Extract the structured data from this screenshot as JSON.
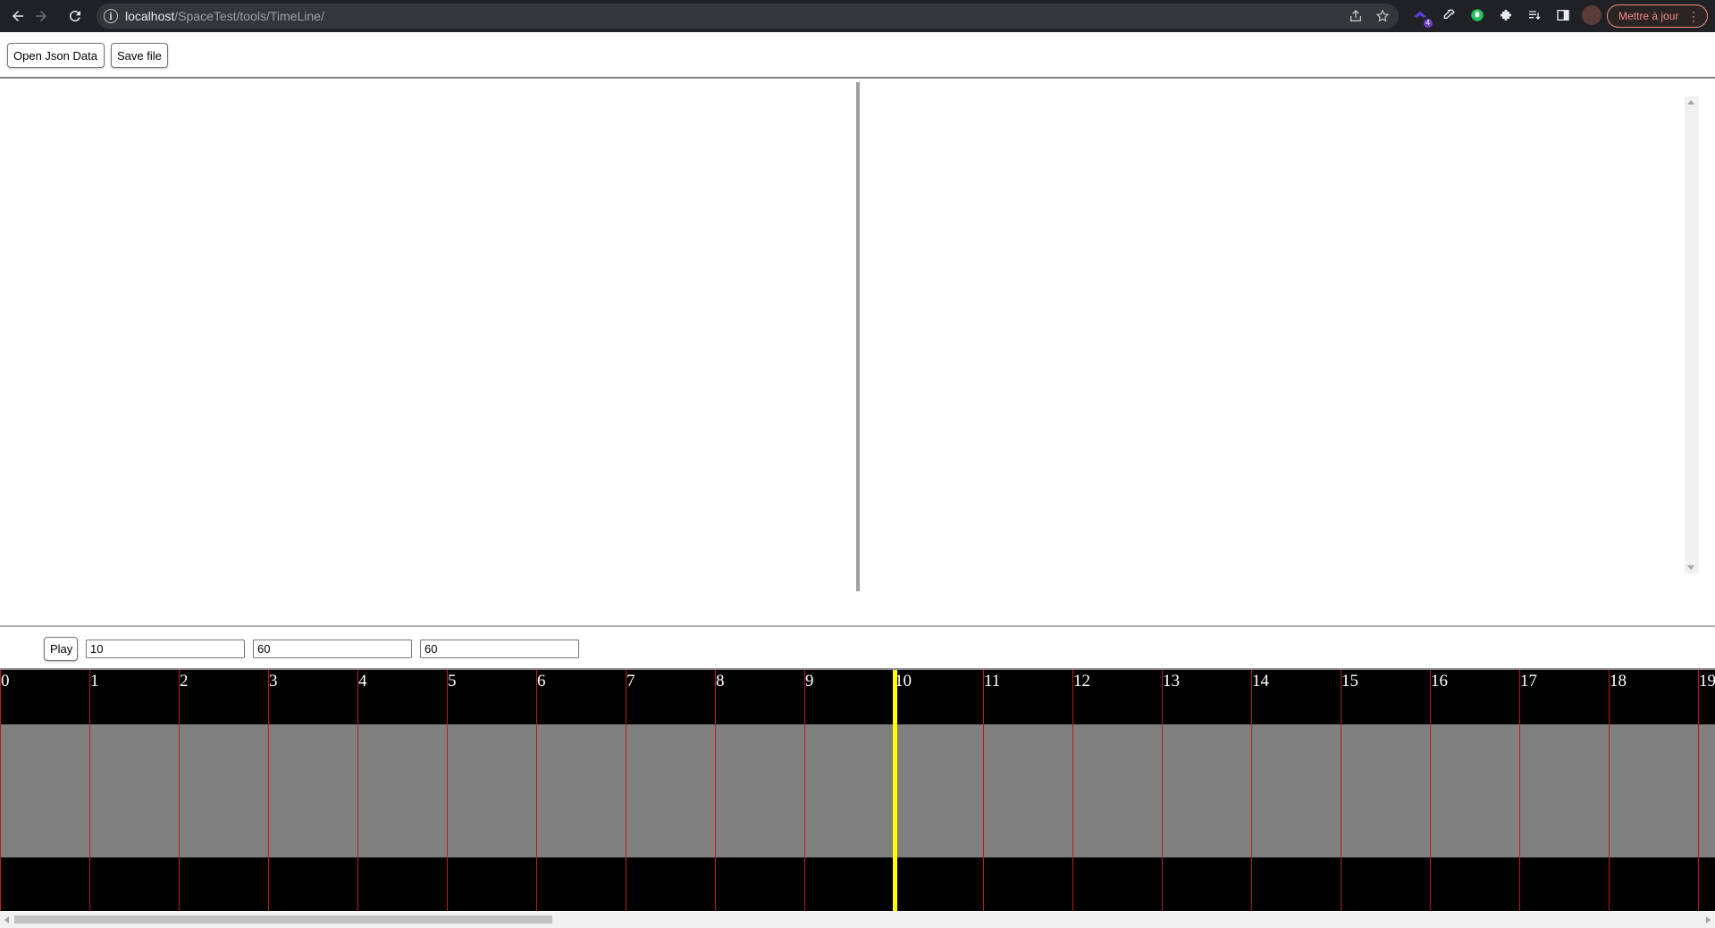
{
  "browser": {
    "url_host": "localhost",
    "url_path": "/SpaceTest/tools/TimeLine/",
    "update_label": "Mettre à jour",
    "extension_badge": "4"
  },
  "toolbar": {
    "open_label": "Open Json Data",
    "save_label": "Save file"
  },
  "controls": {
    "play_label": "Play",
    "input1_value": "10",
    "input2_value": "60",
    "input3_value": "60"
  },
  "timeline": {
    "ticks": [
      "0",
      "1",
      "2",
      "3",
      "4",
      "5",
      "6",
      "7",
      "8",
      "9",
      "10",
      "11",
      "12",
      "13",
      "14",
      "15",
      "16",
      "17",
      "18",
      "19"
    ],
    "current_time": 10,
    "colors": {
      "background": "#000000",
      "track": "#808080",
      "tick_line": "#c0181e",
      "cursor": "#ffff00"
    }
  }
}
